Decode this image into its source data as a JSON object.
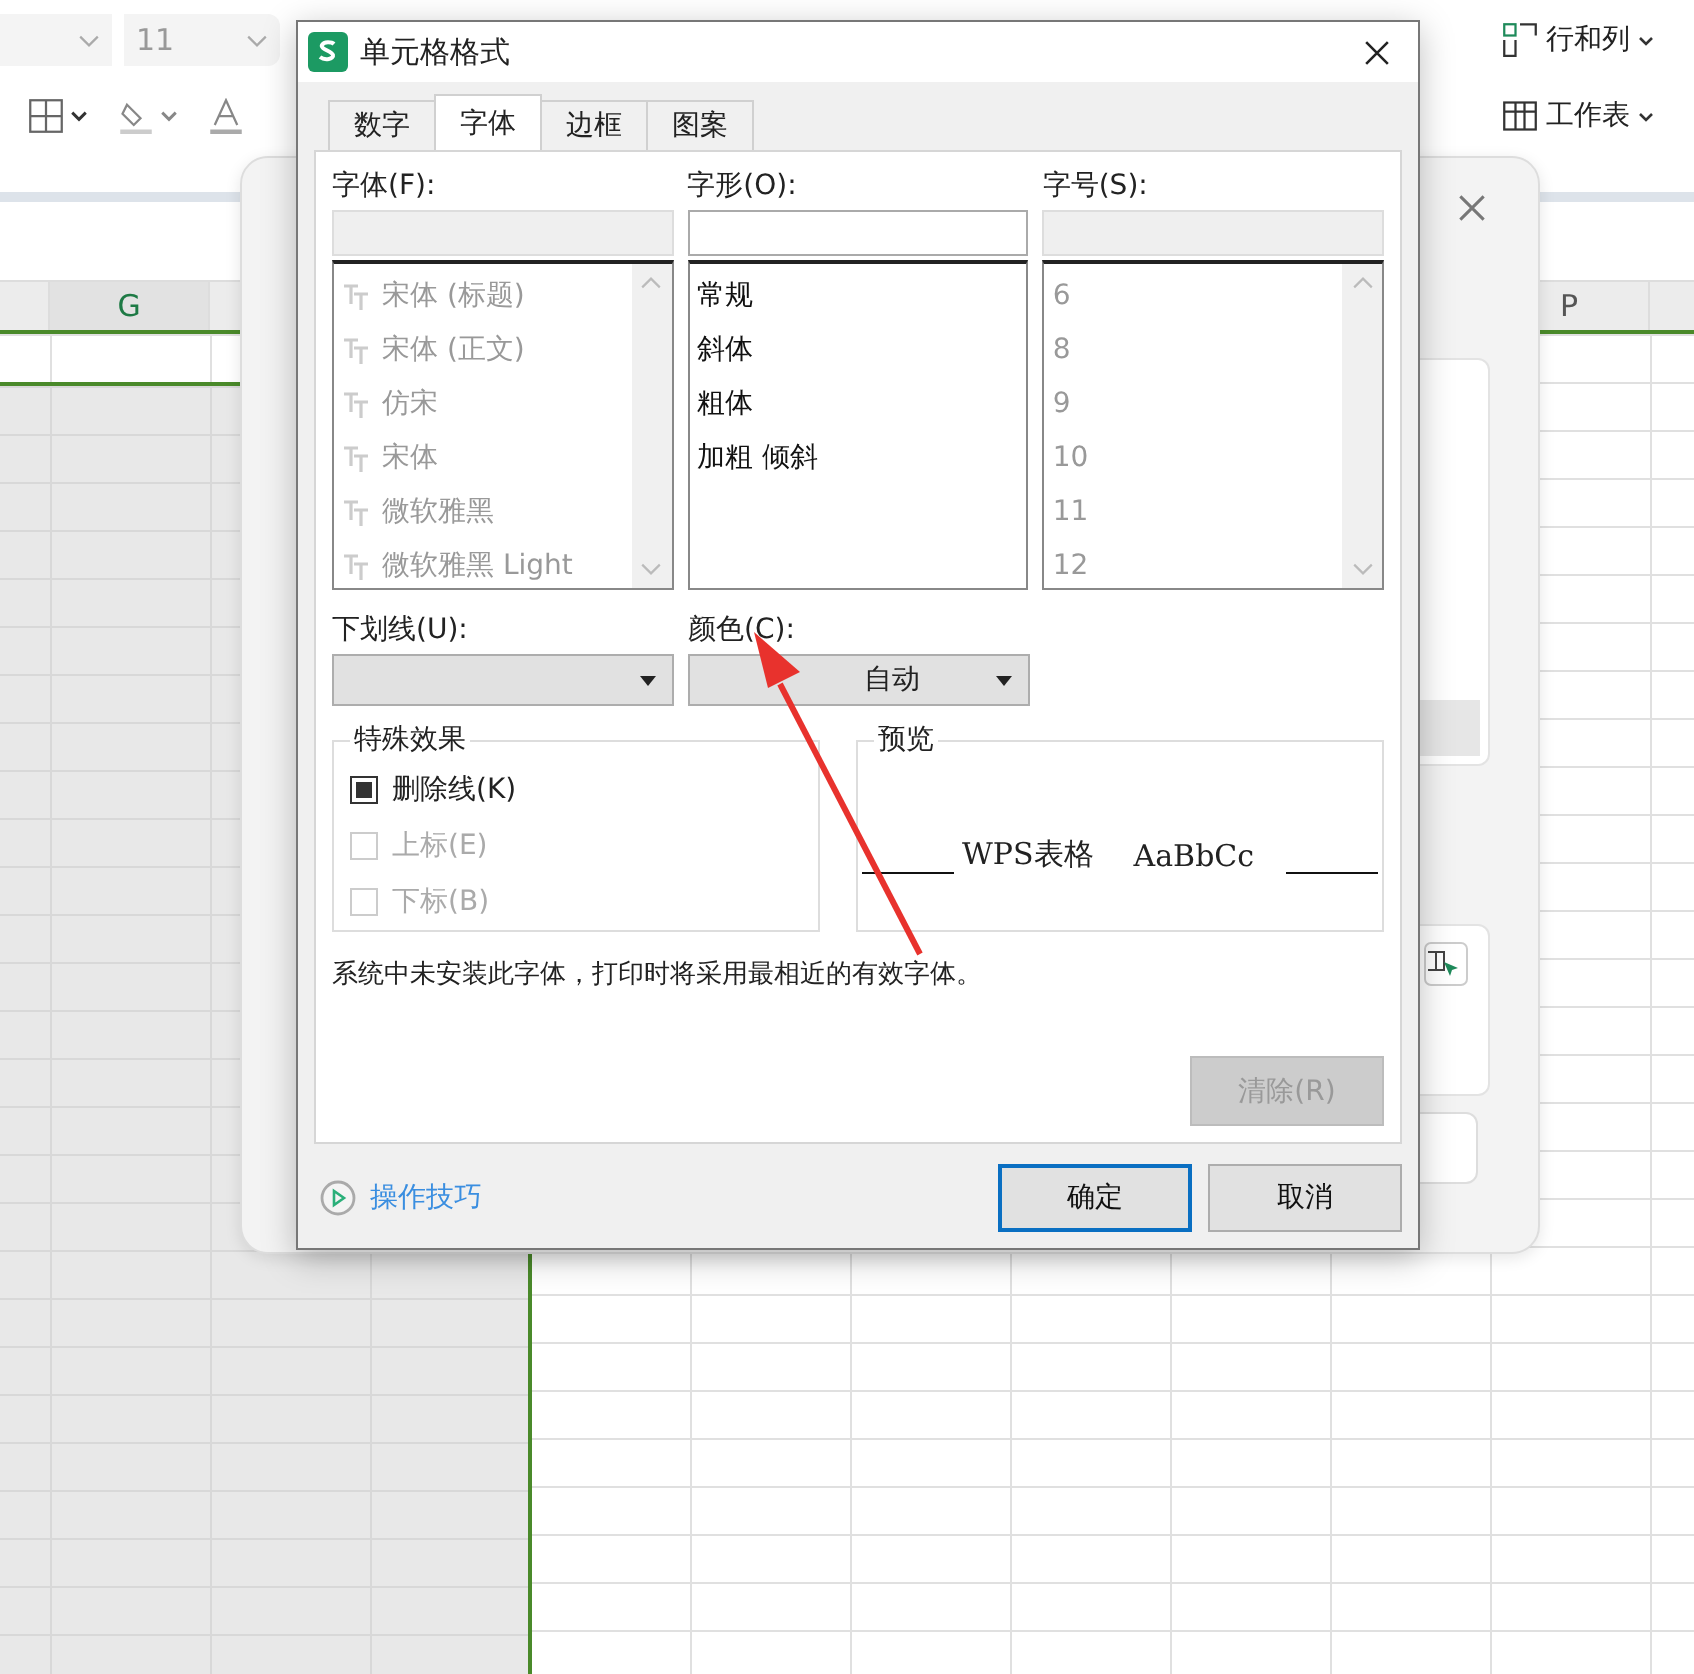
{
  "toolbar": {
    "font_size": "11",
    "row_col_label": "行和列",
    "sheet_label": "工作表"
  },
  "sheet": {
    "columns": [
      {
        "label": "G",
        "selected": true
      },
      {
        "label": "P",
        "selected": false
      }
    ]
  },
  "dialog": {
    "title": "单元格格式",
    "tabs": [
      {
        "label": "数字",
        "selected": false
      },
      {
        "label": "字体",
        "selected": true
      },
      {
        "label": "边框",
        "selected": false
      },
      {
        "label": "图案",
        "selected": false
      }
    ],
    "font": {
      "label": "字体(F):",
      "disabled": true,
      "items": [
        "宋体 (标题)",
        "宋体 (正文)",
        "仿宋",
        "宋体",
        "微软雅黑",
        "微软雅黑 Light"
      ]
    },
    "style": {
      "label": "字形(O):",
      "disabled": false,
      "items": [
        "常规",
        "斜体",
        "粗体",
        "加粗 倾斜"
      ]
    },
    "size": {
      "label": "字号(S):",
      "disabled": true,
      "items": [
        "6",
        "8",
        "9",
        "10",
        "11",
        "12"
      ]
    },
    "underline": {
      "label": "下划线(U):"
    },
    "color": {
      "label": "颜色(C):",
      "value": "自动"
    },
    "effects": {
      "title": "特殊效果",
      "items": [
        {
          "label": "删除线(K)",
          "checked": true,
          "disabled": false
        },
        {
          "label": "上标(E)",
          "checked": false,
          "disabled": true
        },
        {
          "label": "下标(B)",
          "checked": false,
          "disabled": true
        }
      ]
    },
    "preview": {
      "title": "预览",
      "texts": [
        "WPS表格",
        "AaBbCc"
      ]
    },
    "message": "系统中未安装此字体，打印时将采用最相近的有效字体。",
    "clear_button": {
      "label": "清除(R)",
      "disabled": true
    },
    "tips_link": "操作技巧",
    "ok_button": "确定",
    "cancel_button": "取消"
  }
}
